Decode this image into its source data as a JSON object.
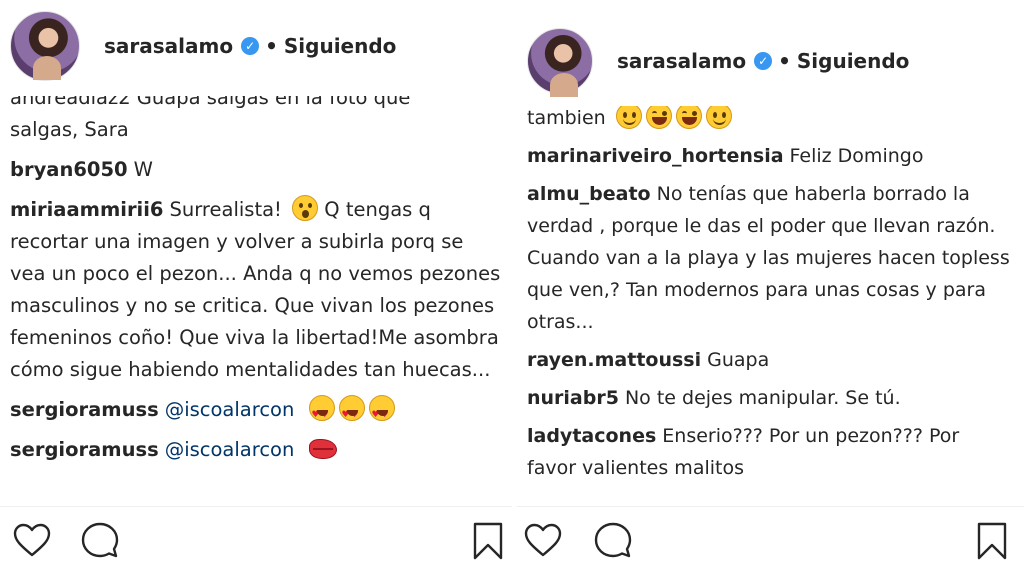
{
  "left": {
    "header": {
      "username": "sarasalamo",
      "separator": "•",
      "follow_label": "Siguiendo"
    },
    "cut_text": "andreadiaz2 Guapa salgas en la foto que",
    "comments": [
      {
        "author": "",
        "text": "salgas, Sara"
      },
      {
        "author": "bryan6050",
        "text": "W"
      },
      {
        "author": "miriaammirii6",
        "text_a": "Surrealista!",
        "text_b": "Q tengas q recortar una imagen y volver a subirla porq se vea un poco el pezon... Anda q no vemos pezones masculinos y no se critica. Que vivan los pezones femeninos coño! Que viva la libertad!Me asombra cómo sigue habiendo mentalidades tan huecas..."
      },
      {
        "author": "sergioramuss",
        "mention": "@iscoalarcon"
      },
      {
        "author": "sergioramuss",
        "mention": "@iscoalarcon"
      }
    ]
  },
  "right": {
    "header": {
      "username": "sarasalamo",
      "separator": "•",
      "follow_label": "Siguiendo"
    },
    "cut_text": "tambien",
    "comments": [
      {
        "author": "marinariveiro_hortensia",
        "text": "Feliz Domingo"
      },
      {
        "author": "almu_beato",
        "text": "No tenías que haberla borrado la verdad , porque le das el poder que llevan razón. Cuando van a la playa y las mujeres hacen topless que ven,? Tan modernos para unas cosas y para otras..."
      },
      {
        "author": "rayen.mattoussi",
        "text": "Guapa"
      },
      {
        "author": "nuriabr5",
        "text": "No te dejes manipular. Se tú."
      },
      {
        "author": "ladytacones",
        "text": "Enserio??? Por un pezon??? Por favor valientes malitos"
      }
    ]
  },
  "icons": {
    "like": "heart-outline-icon",
    "comment": "speech-bubble-icon",
    "save": "bookmark-icon",
    "verified": "verified-badge-icon"
  },
  "colors": {
    "text": "#262626",
    "mention": "#003569",
    "verified": "#3897f0"
  }
}
